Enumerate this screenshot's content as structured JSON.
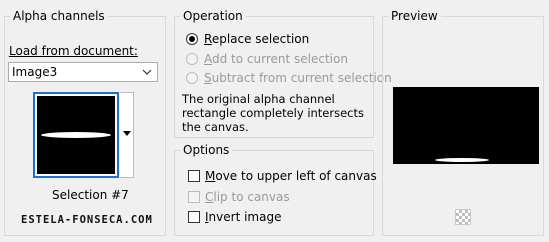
{
  "alpha_channels": {
    "title": "Alpha channels",
    "load_label": "Load from document:",
    "document_value": "Image3",
    "selection_caption": "Selection #7"
  },
  "operation": {
    "title": "Operation",
    "options": [
      {
        "label": "Replace selection",
        "accel": "R",
        "rest": "eplace selection",
        "checked": true,
        "enabled": true
      },
      {
        "label": "Add to current selection",
        "accel": "A",
        "rest": "dd to current selection",
        "checked": false,
        "enabled": false
      },
      {
        "label": "Subtract from current selection",
        "accel": "S",
        "rest": "ubtract from current selection",
        "checked": false,
        "enabled": false
      }
    ],
    "description": "The original alpha channel rectangle completely intersects the canvas."
  },
  "options": {
    "title": "Options",
    "move": {
      "label": "Move to upper left of canvas",
      "accel": "M",
      "rest": "ove to upper left of canvas",
      "checked": false,
      "enabled": true
    },
    "clip": {
      "label": "Clip to canvas",
      "accel": "C",
      "rest": "lip to canvas",
      "checked": false,
      "enabled": false
    },
    "invert": {
      "label": "Invert image",
      "accel": "I",
      "rest": "nvert image",
      "checked": false,
      "enabled": true
    }
  },
  "preview": {
    "title": "Preview"
  },
  "watermark": "ESTELA-FONSECA.COM",
  "icons": {
    "dropdown": "chevron-down-icon",
    "transparency": "checkerboard-icon"
  },
  "colors": {
    "focus_border": "#1a6fd1",
    "disabled_text": "#9a9a9a"
  }
}
